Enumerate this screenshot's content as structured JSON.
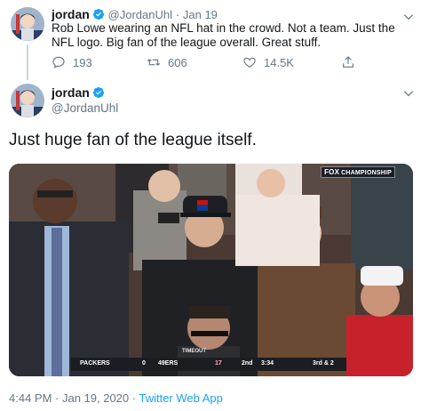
{
  "quoted_tweet": {
    "author_name": "jordan",
    "handle": "@JordanUhl",
    "separator": "·",
    "date": "Jan 19",
    "text": "Rob Lowe wearing an NFL hat in the crowd. Not a team. Just the NFL logo. Big fan of the league overall. Great stuff.",
    "replies": "193",
    "retweets": "606",
    "likes": "14.5K"
  },
  "main_tweet": {
    "author_name": "jordan",
    "handle": "@JordanUhl",
    "text": "Just huge fan of the league itself.",
    "timestamp": "4:44 PM · Jan 19, 2020 · ",
    "source": "Twitter Web App"
  },
  "media": {
    "broadcast_logo": "FOX",
    "broadcast_title": "CHAMPIONSHIP",
    "timeout_label": "TIMEOUT",
    "scoreboard": {
      "team1": "PACKERS",
      "score1": "0",
      "team2": "49ERS",
      "score2": "17",
      "quarter": "2nd",
      "clock": "3:34",
      "down": "3rd & 2"
    }
  },
  "colors": {
    "text": "#14171a",
    "muted": "#657786",
    "link": "#1da1f2",
    "verified": "#1da1f2",
    "score_red": "#c8102e"
  },
  "icons": [
    "verified-badge-icon",
    "chevron-down-icon",
    "reply-icon",
    "retweet-icon",
    "like-icon",
    "share-icon"
  ]
}
